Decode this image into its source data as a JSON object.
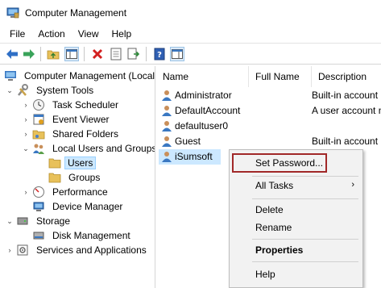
{
  "window": {
    "title": "Computer Management"
  },
  "menu": [
    "File",
    "Action",
    "View",
    "Help"
  ],
  "toolbar": {
    "buttons": [
      "back-icon",
      "forward-icon",
      "up-folder-icon",
      "show-hide-tree-icon",
      "delete-icon",
      "properties-icon",
      "export-icon",
      "help-icon",
      "action-pane-icon"
    ]
  },
  "tree": {
    "root": "Computer Management (Local",
    "system_tools": "System Tools",
    "task_scheduler": "Task Scheduler",
    "event_viewer": "Event Viewer",
    "shared_folders": "Shared Folders",
    "local_users_groups": "Local Users and Groups",
    "users": "Users",
    "groups": "Groups",
    "performance": "Performance",
    "device_manager": "Device Manager",
    "storage": "Storage",
    "disk_management": "Disk Management",
    "services_apps": "Services and Applications"
  },
  "list": {
    "columns": [
      "Name",
      "Full Name",
      "Description"
    ],
    "rows": [
      {
        "name": "Administrator",
        "full_name": "",
        "description": "Built-in account"
      },
      {
        "name": "DefaultAccount",
        "full_name": "",
        "description": "A user account n"
      },
      {
        "name": "defaultuser0",
        "full_name": "",
        "description": ""
      },
      {
        "name": "Guest",
        "full_name": "",
        "description": "Built-in account"
      },
      {
        "name": "iSumsoft",
        "full_name": "",
        "description": ""
      }
    ]
  },
  "context_menu": {
    "set_password": "Set Password...",
    "all_tasks": "All Tasks",
    "delete": "Delete",
    "rename": "Rename",
    "properties": "Properties",
    "help": "Help"
  },
  "colors": {
    "selection": "#cce8ff",
    "highlight_box": "#a12828",
    "folder": "#e8c15a"
  }
}
